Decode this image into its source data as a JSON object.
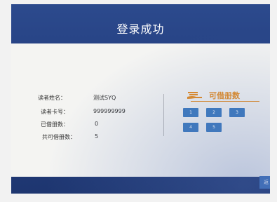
{
  "window": {
    "title": "登录成功"
  },
  "reader_info": {
    "fields": [
      {
        "label": "读者姓名：",
        "value": "测试SYQ"
      },
      {
        "label": "读者卡号：",
        "value": "999999999"
      },
      {
        "label": "已借册数：",
        "value": "0"
      },
      {
        "label": "共可借册数：",
        "value": "5"
      }
    ]
  },
  "available_books": {
    "heading": "可借册数",
    "icon": "hand-books-icon",
    "slots": [
      "1",
      "2",
      "3",
      "4",
      "5"
    ]
  },
  "corner_button": {
    "label": "返"
  },
  "colors": {
    "header_blue": "#2c4a8d",
    "accent_orange": "#e88c1e",
    "slot_blue": "#3d7bbf"
  }
}
